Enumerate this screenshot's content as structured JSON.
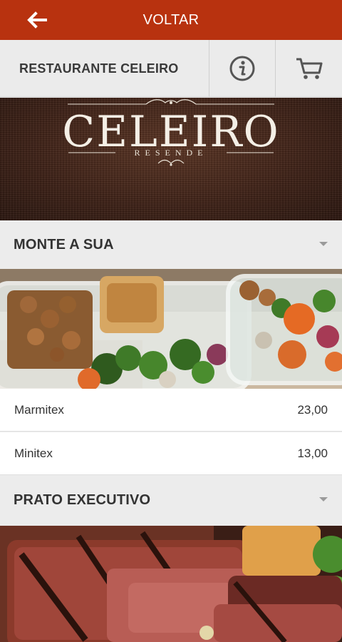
{
  "topbar": {
    "title": "VOLTAR",
    "back_icon": "arrow-left-icon"
  },
  "subbar": {
    "restaurant_name": "RESTAURANTE CELEIRO",
    "info_icon": "info-icon",
    "cart_icon": "cart-icon"
  },
  "banner": {
    "logo_title": "CELEIRO",
    "logo_subtitle": "RESENDE"
  },
  "sections": [
    {
      "title": "MONTE A SUA",
      "image": "meal-prep-containers-photo",
      "items": [
        {
          "name": "Marmitex",
          "price": "23,00"
        },
        {
          "name": "Minitex",
          "price": "13,00"
        }
      ]
    },
    {
      "title": "PRATO EXECUTIVO",
      "image": "grilled-steak-photo",
      "items": []
    }
  ],
  "colors": {
    "accent": "#b8320f",
    "header_bg": "#ececec",
    "text": "#333333"
  }
}
